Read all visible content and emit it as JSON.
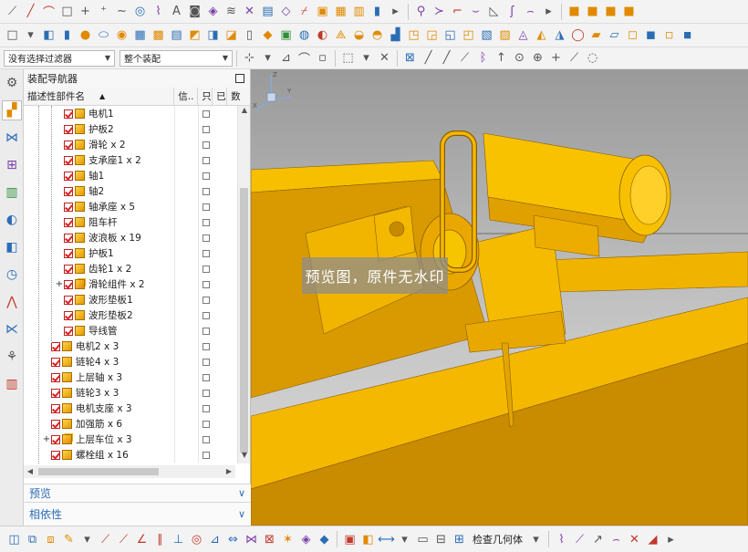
{
  "toolbar": {
    "filter_select": "没有选择过滤器",
    "scope_select": "整个装配",
    "check_geometry_label": "检查几何体"
  },
  "navigator": {
    "title": "装配导航器",
    "columns": {
      "name": "描述性部件名",
      "info": "信..",
      "col3": "只",
      "col4": "已",
      "col5": "数"
    },
    "rows": [
      {
        "label": "电机1",
        "level": 2,
        "expand": "",
        "asm": false
      },
      {
        "label": "护板2",
        "level": 2,
        "expand": "",
        "asm": false
      },
      {
        "label": "滑轮 x 2",
        "level": 2,
        "expand": "",
        "asm": false
      },
      {
        "label": "支承座1 x 2",
        "level": 2,
        "expand": "",
        "asm": false
      },
      {
        "label": "轴1",
        "level": 2,
        "expand": "",
        "asm": false
      },
      {
        "label": "轴2",
        "level": 2,
        "expand": "",
        "asm": false
      },
      {
        "label": "轴承座 x 5",
        "level": 2,
        "expand": "",
        "asm": false
      },
      {
        "label": "阻车杆",
        "level": 2,
        "expand": "",
        "asm": false
      },
      {
        "label": "波浪板 x 19",
        "level": 2,
        "expand": "",
        "asm": false
      },
      {
        "label": "护板1",
        "level": 2,
        "expand": "",
        "asm": false
      },
      {
        "label": "齿轮1 x 2",
        "level": 2,
        "expand": "",
        "asm": false
      },
      {
        "label": "滑轮组件 x 2",
        "level": 2,
        "expand": "+",
        "asm": true
      },
      {
        "label": "波形垫板1",
        "level": 2,
        "expand": "",
        "asm": false
      },
      {
        "label": "波形垫板2",
        "level": 2,
        "expand": "",
        "asm": false
      },
      {
        "label": "导线管",
        "level": 2,
        "expand": "",
        "asm": false
      },
      {
        "label": "电机2 x 3",
        "level": 1,
        "expand": "",
        "asm": false
      },
      {
        "label": "链轮4 x 3",
        "level": 1,
        "expand": "",
        "asm": false
      },
      {
        "label": "上层轴 x 3",
        "level": 1,
        "expand": "",
        "asm": false
      },
      {
        "label": "链轮3 x 3",
        "level": 1,
        "expand": "",
        "asm": false
      },
      {
        "label": "电机支座 x 3",
        "level": 1,
        "expand": "",
        "asm": false
      },
      {
        "label": "加强筋 x 6",
        "level": 1,
        "expand": "",
        "asm": false
      },
      {
        "label": "上层车位 x 3",
        "level": 1,
        "expand": "+",
        "asm": true
      },
      {
        "label": "螺栓组 x 16",
        "level": 1,
        "expand": "",
        "asm": false
      }
    ],
    "sections": {
      "preview": "预览",
      "dependency": "相依性"
    }
  },
  "viewport": {
    "watermark": "预览图，原件无水印",
    "model_color": "#f5b800"
  }
}
